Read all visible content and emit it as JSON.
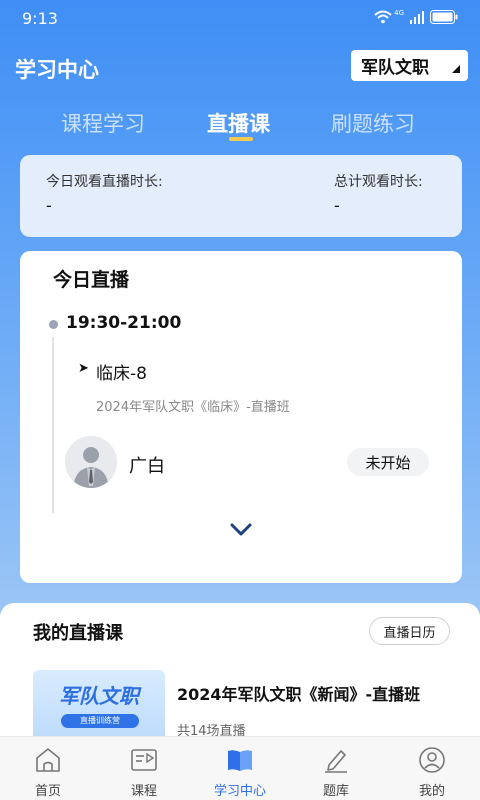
{
  "status_bar": {
    "time": "9:13",
    "network": "4G"
  },
  "header": {
    "title": "学习中心",
    "category": "军队文职"
  },
  "tabs": [
    {
      "label": "课程学习",
      "active": false
    },
    {
      "label": "直播课",
      "active": true
    },
    {
      "label": "刷题练习",
      "active": false
    }
  ],
  "stats": {
    "today_label": "今日观看直播时长:",
    "today_value": "-",
    "total_label": "总计观看时长:",
    "total_value": "-"
  },
  "today_live": {
    "title": "今日直播",
    "time_range": "19:30-21:00",
    "course_name": "临床-8",
    "course_sub": "2024年军队文职《临床》-直播班",
    "teacher": "广白",
    "status": "未开始"
  },
  "my_live": {
    "title": "我的直播课",
    "calendar_button": "直播日历",
    "course": {
      "thumb_title": "军队文职",
      "thumb_sub": "直播训练营",
      "title": "2024年军队文职《新闻》-直播班",
      "sub": "共14场直播"
    }
  },
  "bottom_nav": [
    {
      "label": "首页",
      "icon": "home-icon",
      "active": false
    },
    {
      "label": "课程",
      "icon": "course-icon",
      "active": false
    },
    {
      "label": "学习中心",
      "icon": "book-icon",
      "active": true
    },
    {
      "label": "题库",
      "icon": "pencil-icon",
      "active": false
    },
    {
      "label": "我的",
      "icon": "user-icon",
      "active": false
    }
  ],
  "colors": {
    "accent": "#2f6fe8",
    "tab_indicator": "#f6c84d",
    "header_bg": "#3f8ef5"
  }
}
